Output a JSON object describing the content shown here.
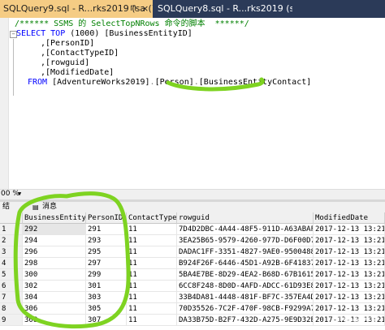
{
  "tabs": {
    "active": {
      "title": "SQLQuery9.sql - R...rks2019 (sa (74))",
      "pin": "⊓",
      "close": "×"
    },
    "inactive": {
      "title": "SQLQuery8.sql - R...rks2019 (sa (69))"
    }
  },
  "editor": {
    "comment": "/****** SSMS 的 SelectTopNRows 命令的脚本  ******/",
    "select_kw": "SELECT",
    "top_kw": "TOP",
    "top_value": "(1000)",
    "col1": "[BusinessEntityID]",
    "lines": [
      ",[PersonID]",
      ",[ContactTypeID]",
      ",[rowguid]",
      ",[ModifiedDate]"
    ],
    "from_kw": "FROM",
    "from_db": "[AdventureWorks2019]",
    "from_schema": "[Person]",
    "from_table": "[BusinessEntityContact]"
  },
  "zoom": "00 %",
  "results_tabs": {
    "results": "结",
    "messages": "消息"
  },
  "columns": [
    "BusinessEntityID",
    "PersonID",
    "ContactTypeID",
    "rowguid",
    "ModifiedDate"
  ],
  "rows": [
    [
      "1",
      "292",
      "291",
      "11",
      "7D4D2DBC-4A44-48F5-911D-A63ABAFD5120",
      "2017-12-13 13:21:02"
    ],
    [
      "2",
      "294",
      "293",
      "11",
      "3EA25B65-9579-4260-977D-D6F00D7D20EE",
      "2017-12-13 13:21:02"
    ],
    [
      "3",
      "296",
      "295",
      "11",
      "DADAC1FF-3351-4827-9AE0-95004885C193",
      "2017-12-13 13:21:02"
    ],
    [
      "4",
      "298",
      "297",
      "11",
      "B924F26F-6446-45D1-A92B-6F418374F075",
      "2017-12-13 13:21:02"
    ],
    [
      "5",
      "300",
      "299",
      "11",
      "5BA4E7BE-8D29-4EA2-B68D-67B1615B124A",
      "2017-12-13 13:21:02"
    ],
    [
      "6",
      "302",
      "301",
      "11",
      "6CC8F248-8D0D-4AFD-ADCC-61D93E8DE3B1",
      "2017-12-13 13:21:02"
    ],
    [
      "7",
      "304",
      "303",
      "11",
      "33B4DA81-4448-481F-BF7C-357EA4D23F21",
      "2017-12-13 13:21:02"
    ],
    [
      "8",
      "306",
      "305",
      "11",
      "70D35526-7C2F-470F-98CB-F9299A754F16",
      "2017-12-13 13:21:02"
    ],
    [
      "9",
      "308",
      "307",
      "11",
      "DA33B75D-B2F7-432D-A275-9E9D32E78F3E",
      "2017-12-13 13:21:02"
    ]
  ],
  "watermark": "知乎 @大罗",
  "annotation_color": "#7ed321"
}
